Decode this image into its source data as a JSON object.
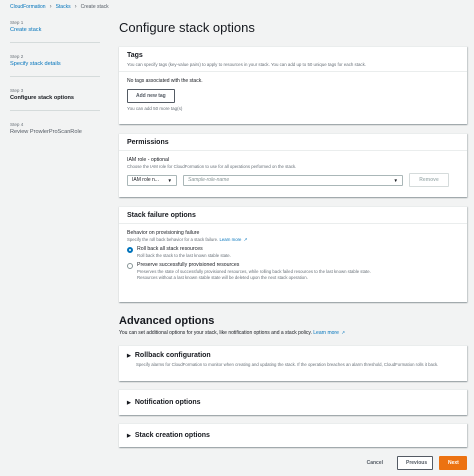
{
  "breadcrumb": {
    "items": [
      "CloudFormation",
      "Stacks"
    ],
    "current": "Create stack"
  },
  "steps": [
    {
      "num": "Step 1",
      "label": "Create stack"
    },
    {
      "num": "Step 2",
      "label": "Specify stack details"
    },
    {
      "num": "Step 3",
      "label": "Configure stack options"
    },
    {
      "num": "Step 4",
      "label": "Review ProwlerProScanRole"
    }
  ],
  "page_title": "Configure stack options",
  "tags": {
    "title": "Tags",
    "desc": "You can specify tags (key-value pairs) to apply to resources in your stack. You can add up to 50 unique tags for each stack.",
    "empty": "No tags associated with the stack.",
    "add_button": "Add new tag",
    "remaining": "You can add 50 more tag(s)"
  },
  "permissions": {
    "title": "Permissions",
    "field_label": "IAM role - optional",
    "field_desc": "Choose the IAM role for CloudFormation to use for all operations performed on the stack.",
    "select_value": "IAM role n...",
    "input_placeholder": "Sample-role-name",
    "remove_button": "Remove"
  },
  "failure": {
    "title": "Stack failure options",
    "field_label": "Behavior on provisioning failure",
    "field_desc": "Specify the roll back behavior for a stack failure.",
    "learn_more": "Learn more",
    "options": [
      {
        "title": "Roll back all stack resources",
        "desc": "Roll back the stack to the last known stable state."
      },
      {
        "title": "Preserve successfully provisioned resources",
        "desc": "Preserves the state of successfully provisioned resources, while rolling back failed resources to the last known stable state. Resources without a last known stable state will be deleted upon the next stack operation."
      }
    ]
  },
  "advanced": {
    "title": "Advanced options",
    "desc": "You can set additional options for your stack, like notification options and a stack policy.",
    "learn_more": "Learn more",
    "sections": [
      {
        "title": "Rollback configuration",
        "desc": "Specify alarms for CloudFormation to monitor when creating and updating the stack. If the operation breaches an alarm threshold, CloudFormation rolls it back."
      },
      {
        "title": "Notification options"
      },
      {
        "title": "Stack creation options"
      }
    ]
  },
  "footer": {
    "cancel": "Cancel",
    "previous": "Previous",
    "next": "Next"
  },
  "colors": {
    "link": "#0073bb",
    "primary": "#ec7211"
  },
  "icons": {
    "separator": "chevron-right-icon",
    "external": "external-link-icon",
    "expand": "caret-right-icon"
  }
}
